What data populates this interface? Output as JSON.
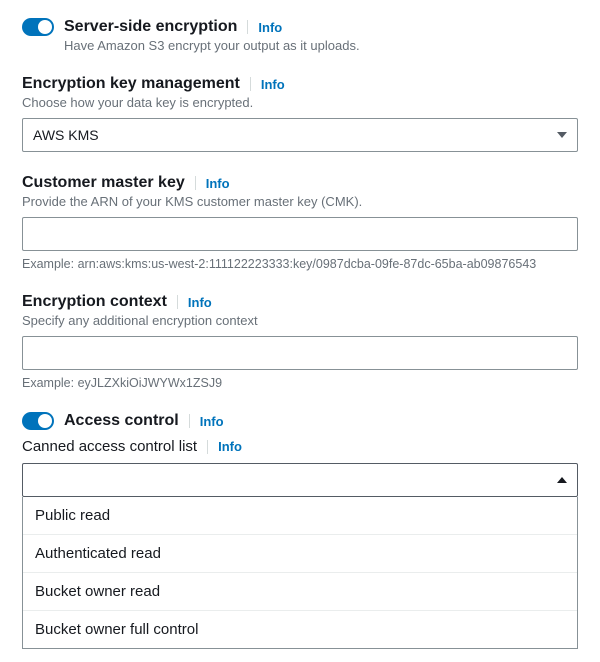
{
  "sse": {
    "title": "Server-side encryption",
    "info": "Info",
    "desc": "Have Amazon S3 encrypt your output as it uploads."
  },
  "key_mgmt": {
    "title": "Encryption key management",
    "info": "Info",
    "desc": "Choose how your data key is encrypted.",
    "selected": "AWS KMS"
  },
  "cmk": {
    "title": "Customer master key",
    "info": "Info",
    "desc": "Provide the ARN of your KMS customer master key (CMK).",
    "value": "",
    "example": "Example: arn:aws:kms:us-west-2:111122223333:key/0987dcba-09fe-87dc-65ba-ab09876543"
  },
  "enc_ctx": {
    "title": "Encryption context",
    "info": "Info",
    "desc": "Specify any additional encryption context",
    "value": "",
    "example": "Example: eyJLZXkiOiJWYWx1ZSJ9"
  },
  "access": {
    "title": "Access control",
    "info": "Info"
  },
  "canned_acl": {
    "title": "Canned access control list",
    "info": "Info",
    "selected": "",
    "options": [
      "Public read",
      "Authenticated read",
      "Bucket owner read",
      "Bucket owner full control"
    ]
  }
}
